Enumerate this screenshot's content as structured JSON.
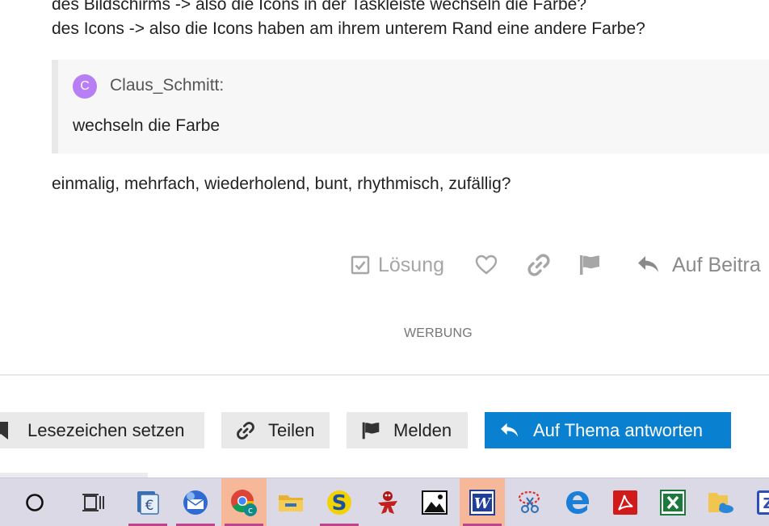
{
  "post": {
    "line1": "des Bildschirms -> also die Icons in der Taskleiste wechseln die Farbe?",
    "line2": "des Icons -> also die Icons haben am ihrem unterem Rand eine andere Farbe?",
    "quote": {
      "avatar_letter": "C",
      "author": "Claus_Schmitt:",
      "text": "wechseln die Farbe"
    },
    "line3": "einmalig, mehrfach, wiederholend, bunt, rhythmisch, zufällig?"
  },
  "post_actions": {
    "solution_label": "Lösung",
    "like_icon": "heart-icon",
    "link_icon": "link-icon",
    "flag_icon": "flag-icon",
    "reply_label": "Auf Beitra"
  },
  "ad_label": "WERBUNG",
  "topic_buttons": {
    "bookmark_label": "Lesezeichen setzen",
    "share_label": "Teilen",
    "flag_label": "Melden",
    "reply_label": "Auf Thema antworten"
  },
  "colors": {
    "accent": "#0a80d0",
    "avatar": "#b77ef5",
    "taskbar": "#dcd9e6",
    "active_app": "#f7b89a",
    "running_underline": "#c0448c"
  },
  "taskbar": {
    "items": [
      {
        "icon": "search-circle-icon",
        "active": false,
        "running": false
      },
      {
        "icon": "task-view-icon",
        "active": false,
        "running": false
      },
      {
        "icon": "euro-calculator-icon",
        "active": false,
        "running": true
      },
      {
        "icon": "thunderbird-icon",
        "active": false,
        "running": true
      },
      {
        "icon": "chrome-icon",
        "active": true,
        "running": true
      },
      {
        "icon": "file-explorer-icon",
        "active": false,
        "running": false
      },
      {
        "icon": "s-app-icon",
        "active": false,
        "running": true
      },
      {
        "icon": "red-figure-icon",
        "active": false,
        "running": false
      },
      {
        "icon": "photos-icon",
        "active": false,
        "running": false
      },
      {
        "icon": "word-icon",
        "active": true,
        "running": true
      },
      {
        "icon": "snipping-tool-icon",
        "active": false,
        "running": false
      },
      {
        "icon": "edge-icon",
        "active": false,
        "running": false
      },
      {
        "icon": "acrobat-icon",
        "active": false,
        "running": false
      },
      {
        "icon": "excel-icon",
        "active": false,
        "running": false
      },
      {
        "icon": "onedrive-folder-icon",
        "active": false,
        "running": false
      },
      {
        "icon": "z-app-icon",
        "active": false,
        "running": false
      }
    ]
  }
}
